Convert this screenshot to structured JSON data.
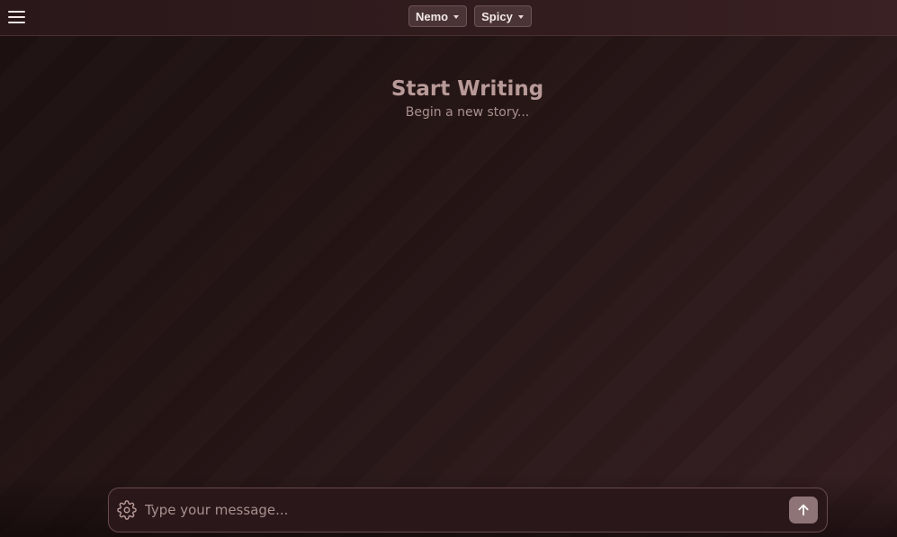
{
  "header": {
    "menu_icon": "hamburger-icon",
    "model_select": {
      "label": "Nemo",
      "icon": "caret-down-icon"
    },
    "style_select": {
      "label": "Spicy",
      "icon": "caret-down-icon"
    }
  },
  "main": {
    "title": "Start Writing",
    "subtitle": "Begin a new story..."
  },
  "composer": {
    "settings_icon": "gear-icon",
    "placeholder": "Type your message...",
    "value": "",
    "send_icon": "arrow-up-icon"
  },
  "colors": {
    "background": "#251515",
    "accent": "#8e7476",
    "text_muted": "#a8908e"
  }
}
